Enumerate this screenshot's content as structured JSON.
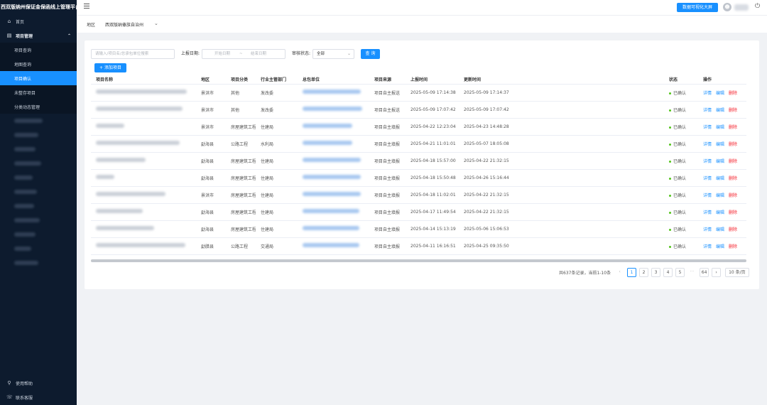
{
  "app": {
    "title": "西双版纳州保证金保函线上管理平台"
  },
  "sidebar": {
    "home": "首页",
    "group": "项目管理",
    "items": [
      "项目查询",
      "地图查询",
      "项目确认",
      "未整存项目",
      "分类动态管理"
    ],
    "help": "使用帮助",
    "contact": "联系客服"
  },
  "header": {
    "screen_button": "数据可视化大屏",
    "avatar_icon": "user-icon"
  },
  "region": {
    "label": "地区",
    "value": "西双版纳傣族自治州"
  },
  "filters": {
    "search_placeholder": "请输入/项目名/总承包单位搜索",
    "date_label": "上报日期:",
    "start_placeholder": "开始日期",
    "date_sep": "~",
    "end_placeholder": "结束日期",
    "status_label": "审核状态:",
    "status_value": "全部",
    "query_button": "查 询",
    "add_button": "+ 添加项目"
  },
  "table": {
    "headers": [
      "项目名称",
      "地区",
      "项目分类",
      "行业主管部门",
      "总包单位",
      "项目来源",
      "上报时间",
      "更新时间",
      "状态",
      "操作"
    ],
    "rows": [
      {
        "region": "景洪市",
        "category": "其他",
        "dept": "发改委",
        "source": "项目自主报送",
        "reported": "2025-05-09 17:14:38",
        "updated": "2025-05-09 17:14:37",
        "status": "已确认"
      },
      {
        "region": "景洪市",
        "category": "其他",
        "dept": "发改委",
        "source": "项目自主报送",
        "reported": "2025-05-09 17:07:42",
        "updated": "2025-05-09 17:07:42",
        "status": "已确认"
      },
      {
        "region": "景洪市",
        "category": "房屋建筑工程",
        "dept": "住建局",
        "source": "项目自主填报",
        "reported": "2025-04-22 12:23:04",
        "updated": "2025-04-23 14:48:28",
        "status": "已确认"
      },
      {
        "region": "勐海县",
        "category": "公路工程",
        "dept": "水利局",
        "source": "项目自主填报",
        "reported": "2025-04-21 11:01:01",
        "updated": "2025-05-07 18:05:08",
        "status": "已确认"
      },
      {
        "region": "勐海县",
        "category": "房屋建筑工程",
        "dept": "住建局",
        "source": "项目自主填报",
        "reported": "2025-04-18 15:57:00",
        "updated": "2025-04-22 21:32:15",
        "status": "已确认"
      },
      {
        "region": "勐海县",
        "category": "房屋建筑工程",
        "dept": "住建局",
        "source": "项目自主填报",
        "reported": "2025-04-18 15:50:48",
        "updated": "2025-04-26 15:16:44",
        "status": "已确认"
      },
      {
        "region": "景洪市",
        "category": "房屋建筑工程",
        "dept": "住建局",
        "source": "项目自主填报",
        "reported": "2025-04-18 11:02:01",
        "updated": "2025-04-22 21:32:15",
        "status": "已确认"
      },
      {
        "region": "勐海县",
        "category": "房屋建筑工程",
        "dept": "住建局",
        "source": "项目自主填报",
        "reported": "2025-04-17 11:49:54",
        "updated": "2025-04-22 21:32:15",
        "status": "已确认"
      },
      {
        "region": "勐海县",
        "category": "房屋建筑工程",
        "dept": "住建局",
        "source": "项目自主填报",
        "reported": "2025-04-14 15:13:19",
        "updated": "2025-05-06 15:06:53",
        "status": "已确认"
      },
      {
        "region": "勐腊县",
        "category": "公路工程",
        "dept": "交通局",
        "source": "项目自主填报",
        "reported": "2025-04-11 16:16:51",
        "updated": "2025-04-25 09:35:50",
        "status": "已确认"
      }
    ],
    "ops": {
      "detail": "详情",
      "edit": "编辑",
      "delete": "删除"
    }
  },
  "pagination": {
    "total": "共637条记录，当前1-10条",
    "pages": [
      "1",
      "2",
      "3",
      "4",
      "5"
    ],
    "ellipsis": "···",
    "last": "64",
    "page_size": "10 条/页"
  }
}
